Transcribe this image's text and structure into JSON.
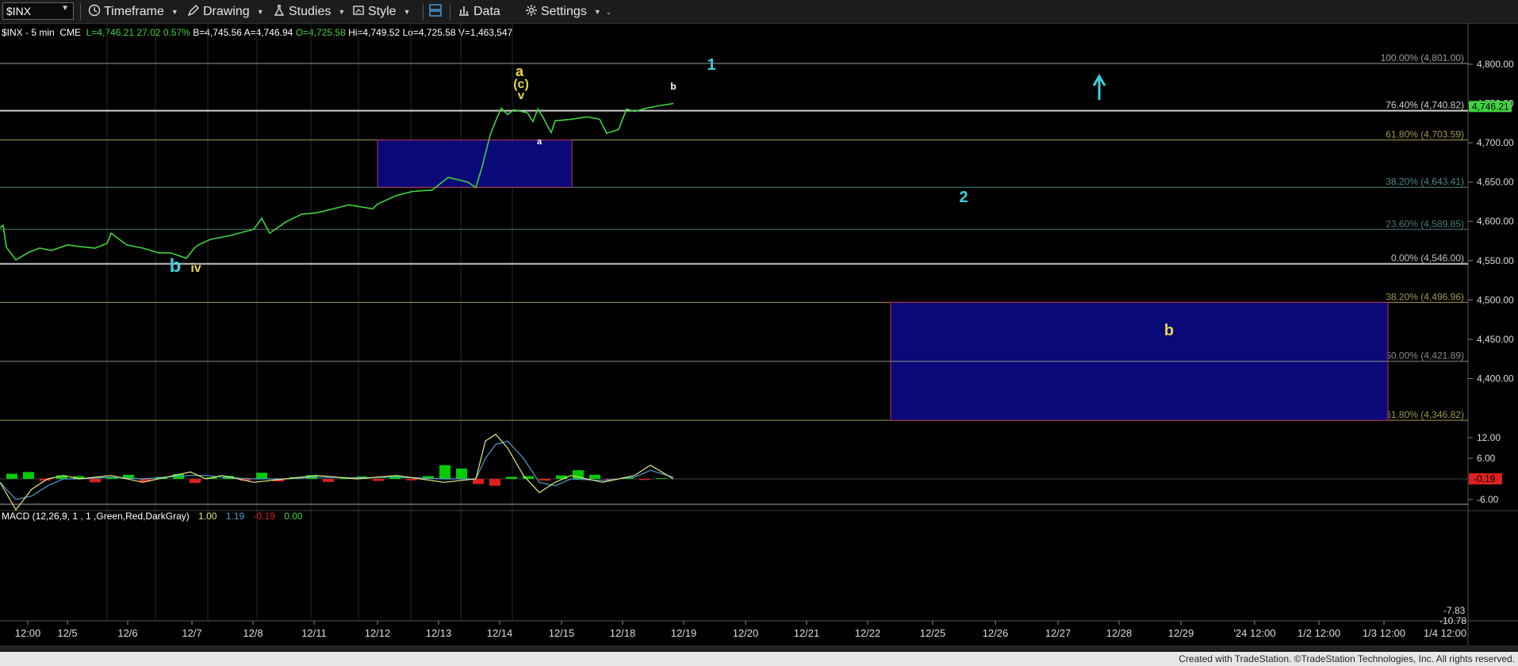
{
  "toolbar": {
    "symbol": "$INX",
    "timeframe": "Timeframe",
    "drawing": "Drawing",
    "studies": "Studies",
    "style": "Style",
    "data": "Data",
    "settings": "Settings"
  },
  "info": {
    "name": "$INX - 5 min  CME",
    "last": "L=4,746.21",
    "change": "27.02",
    "change_pct": "0.57%",
    "bid": "B=4,745.56",
    "ask": "A=4,746.94",
    "open": "O=4,725.58",
    "high": "Hi=4,749.52",
    "low": "Lo=4,725.58",
    "volume": "V=1,463,547"
  },
  "macd_info": {
    "label": "MACD (12,26,9, 1 , 1 ,Green,Red,DarkGray)",
    "v1": "1.00",
    "v2": "1.19",
    "v3": "-0.19",
    "v4": "0.00"
  },
  "footer": "Created with TradeStation. ©TradeStation Technologies, Inc. All rights reserved.",
  "price_axis": {
    "ticks": [
      "4,800.00",
      "4,750.00",
      "4,700.00",
      "4,650.00",
      "4,600.00",
      "4,550.00",
      "4,500.00",
      "4,450.00",
      "4,400.00"
    ],
    "last_price_tag": "4,746.21"
  },
  "macd_axis": {
    "ticks": [
      "12.00",
      "6.00",
      "-6.00"
    ],
    "tag_current": "-0.19",
    "tag_min1": "-7.83",
    "tag_min2": "-10.78"
  },
  "x_axis": {
    "labels": [
      "12:00",
      "12/5",
      "12/6",
      "12/7",
      "12/8",
      "12/11",
      "12/12",
      "12/13",
      "12/14",
      "12/15",
      "12/18",
      "12/19",
      "12/20",
      "12/21",
      "12/22",
      "12/25",
      "12/26",
      "12/27",
      "12/28",
      "12/29",
      "'24 12:00",
      "1/2 12:00",
      "1/3 12:00",
      "1/4 12:00"
    ]
  },
  "fib_levels": [
    {
      "label": "100.00% (4,801.00)",
      "value": 4801.0,
      "color": "#9a9a9a"
    },
    {
      "label": "76.40% (4,740.82)",
      "value": 4740.82,
      "color": "#d0d0d0"
    },
    {
      "label": "61.80% (4,703.59)",
      "value": 4703.59,
      "color": "#a09a50"
    },
    {
      "label": "38.20% (4,643.41)",
      "value": 4643.41,
      "color": "#4a8a8a"
    },
    {
      "label": "23.60% (4,589.85)",
      "value": 4589.85,
      "color": "#4a7a7a"
    },
    {
      "label": "0.00% (4,546.00)",
      "value": 4546.0,
      "color": "#c0c0c0"
    },
    {
      "label": "38.20% (4,496.96)",
      "value": 4496.96,
      "color": "#a09a50"
    },
    {
      "label": "50.00% (4,421.89)",
      "value": 4421.89,
      "color": "#8a8a8a"
    },
    {
      "label": "61.80% (4,346.82)",
      "value": 4346.82,
      "color": "#a09a50"
    }
  ],
  "wave_labels": [
    {
      "text": "1",
      "color": "#3ecfe0"
    },
    {
      "text": "a",
      "color": "#e8d84a"
    },
    {
      "text": "(c)",
      "color": "#e8d84a"
    },
    {
      "text": "v",
      "color": "#e8d84a"
    },
    {
      "text": "b",
      "color": "#ffffff"
    },
    {
      "text": "a",
      "color": "#ffffff"
    },
    {
      "text": "2",
      "color": "#3ecfe0"
    },
    {
      "text": "b",
      "color": "#3ecfe0"
    },
    {
      "text": "iv",
      "color": "#e8d84a"
    },
    {
      "text": "b",
      "color": "#e8d84a"
    }
  ],
  "colors": {
    "price_line": "#3fd43f",
    "box_fill": "#0a0a8c",
    "box_border": "#c03050",
    "macd_line": "#e8e880",
    "signal_line": "#50a0d0",
    "hist_pos": "#00cc00",
    "hist_neg": "#dd2020",
    "arrow": "#3ecfe0"
  },
  "chart_data": {
    "type": "line",
    "title": "$INX - 5 min",
    "ylim": [
      4346,
      4830
    ],
    "x": [
      "12/4",
      "12/5",
      "12/6",
      "12/7",
      "12/8",
      "12/11",
      "12/12",
      "12/13",
      "12/14",
      "12/15",
      "12/18"
    ],
    "series": [
      {
        "name": "$INX",
        "values": [
          4570,
          4565,
          4575,
          4560,
          4575,
          4605,
          4615,
          4640,
          4740,
          4718,
          4746
        ]
      }
    ],
    "macd": {
      "label": "MACD (12,26,9, 1 , 1 ,Green,Red,DarkGray)",
      "ylim": [
        -10.78,
        14
      ],
      "values": [
        -1,
        1,
        0,
        1,
        2,
        0,
        1,
        1,
        1,
        13,
        4,
        -2,
        1,
        4,
        1
      ]
    }
  }
}
